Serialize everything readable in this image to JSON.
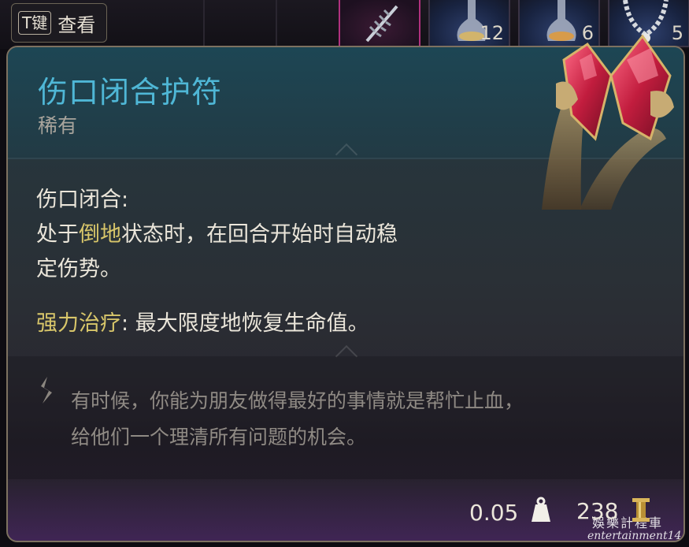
{
  "hint": {
    "key": "T键",
    "label": "查看"
  },
  "inventory_slots": [
    {
      "icon": "feather-blade-icon",
      "count": ""
    },
    {
      "icon": "potion-flask-icon",
      "count": "12"
    },
    {
      "icon": "potion-flask-icon",
      "count": "6"
    },
    {
      "icon": "chain-amulet-icon",
      "count": "5"
    }
  ],
  "item": {
    "name": "伤口闭合护符",
    "rarity": "稀有",
    "effect_title": "伤口闭合:",
    "effect_line1_pre": "处于",
    "effect_line1_hl": "倒地",
    "effect_line1_post": "状态时，在回合开始时自动稳",
    "effect_line2": "定伤势。",
    "heal_label": "强力治疗",
    "heal_text": ": 最大限度地恢复生命值。",
    "flavor_line1": "有时候，你能为朋友做得最好的事情就是帮忙止血，",
    "flavor_line2": "给他们一个理清所有问题的机会。",
    "weight": "0.05",
    "value": "238"
  },
  "icons": {
    "weight": "weight-icon",
    "gold": "gold-coin-icon",
    "flavor": "quill-icon",
    "art": "amulet-hands-icon"
  },
  "watermark": {
    "cn": "娛樂計程車",
    "en": "entertainment14"
  },
  "colors": {
    "title": "#4fb7d6",
    "highlight": "#d8c66a",
    "rarity": "#a8a49c",
    "flavor": "#8f8a84",
    "border": "#7d7160"
  }
}
